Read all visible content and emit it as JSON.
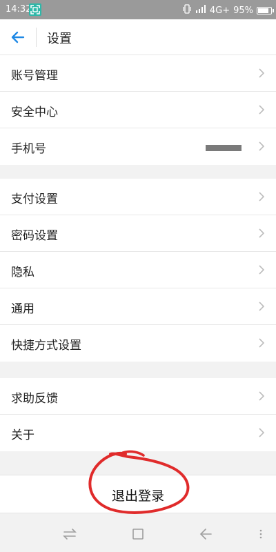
{
  "status_bar": {
    "time": "14:32",
    "network": "4G+",
    "battery": "95%",
    "battery_level": 0.95
  },
  "header": {
    "title": "设置"
  },
  "sections": [
    {
      "items": [
        {
          "label": "账号管理"
        },
        {
          "label": "安全中心"
        },
        {
          "label": "手机号"
        }
      ]
    },
    {
      "items": [
        {
          "label": "支付设置"
        },
        {
          "label": "密码设置"
        },
        {
          "label": "隐私"
        },
        {
          "label": "通用"
        },
        {
          "label": "快捷方式设置"
        }
      ]
    },
    {
      "items": [
        {
          "label": "求助反馈"
        },
        {
          "label": "关于"
        }
      ]
    }
  ],
  "logout": {
    "label": "退出登录"
  },
  "colors": {
    "accent": "#1e88e5",
    "annotation": "#e02b2b",
    "status_bar": "#9a9a9a"
  }
}
